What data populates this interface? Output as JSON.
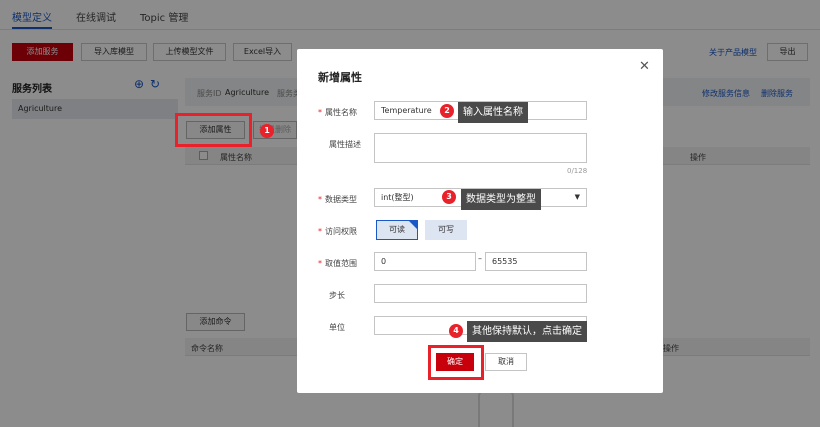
{
  "tabs": [
    "模型定义",
    "在线调试",
    "Topic 管理"
  ],
  "toolbar": {
    "add_service": "添加服务",
    "import_library_model": "导入库模型",
    "upload_model_file": "上传模型文件",
    "excel_import": "Excel导入",
    "about_product_model": "关于产品模型",
    "export": "导出"
  },
  "sidebar": {
    "title": "服务列表",
    "add_icon": "⊕",
    "refresh_icon": "↻",
    "items": [
      {
        "label": "Agriculture"
      }
    ]
  },
  "service_info": {
    "id_label": "服务ID",
    "id_value": "Agriculture",
    "type_label_partial": "服务类",
    "modify_link": "修改服务信息",
    "delete_link": "删除服务"
  },
  "properties": {
    "add_button": "添加属性",
    "batch_delete_partial": "批量删除",
    "col_name": "属性名称",
    "col_action": "操作"
  },
  "commands": {
    "add_button": "添加命令",
    "col_name": "命令名称",
    "col_action_partial": "操作"
  },
  "dialog": {
    "title": "新增属性",
    "close_icon": "✕",
    "fields": {
      "name": {
        "label": "属性名称",
        "value": "Temperature"
      },
      "desc": {
        "label": "属性描述",
        "count": "0/128"
      },
      "type": {
        "label": "数据类型",
        "value": "int(整型)"
      },
      "access": {
        "label": "访问权限",
        "options": [
          "可读",
          "可写"
        ],
        "selected": "可读"
      },
      "range": {
        "label": "取值范围",
        "min": "0",
        "max": "65535",
        "separator": "–"
      },
      "step": {
        "label": "步长",
        "value": ""
      },
      "unit": {
        "label": "单位",
        "value": ""
      }
    },
    "required_mark": "*",
    "confirm": "确定",
    "cancel": "取消"
  },
  "annotations": [
    {
      "number": "1",
      "text": ""
    },
    {
      "number": "2",
      "text": "输入属性名称"
    },
    {
      "number": "3",
      "text": "数据类型为整型"
    },
    {
      "number": "4",
      "text": "其他保持默认，点击确定"
    }
  ],
  "colors": {
    "accent": "#1a58c7",
    "primary": "#c7000b",
    "highlight": "#e8212a",
    "tooltip": "#4a4a4a"
  }
}
